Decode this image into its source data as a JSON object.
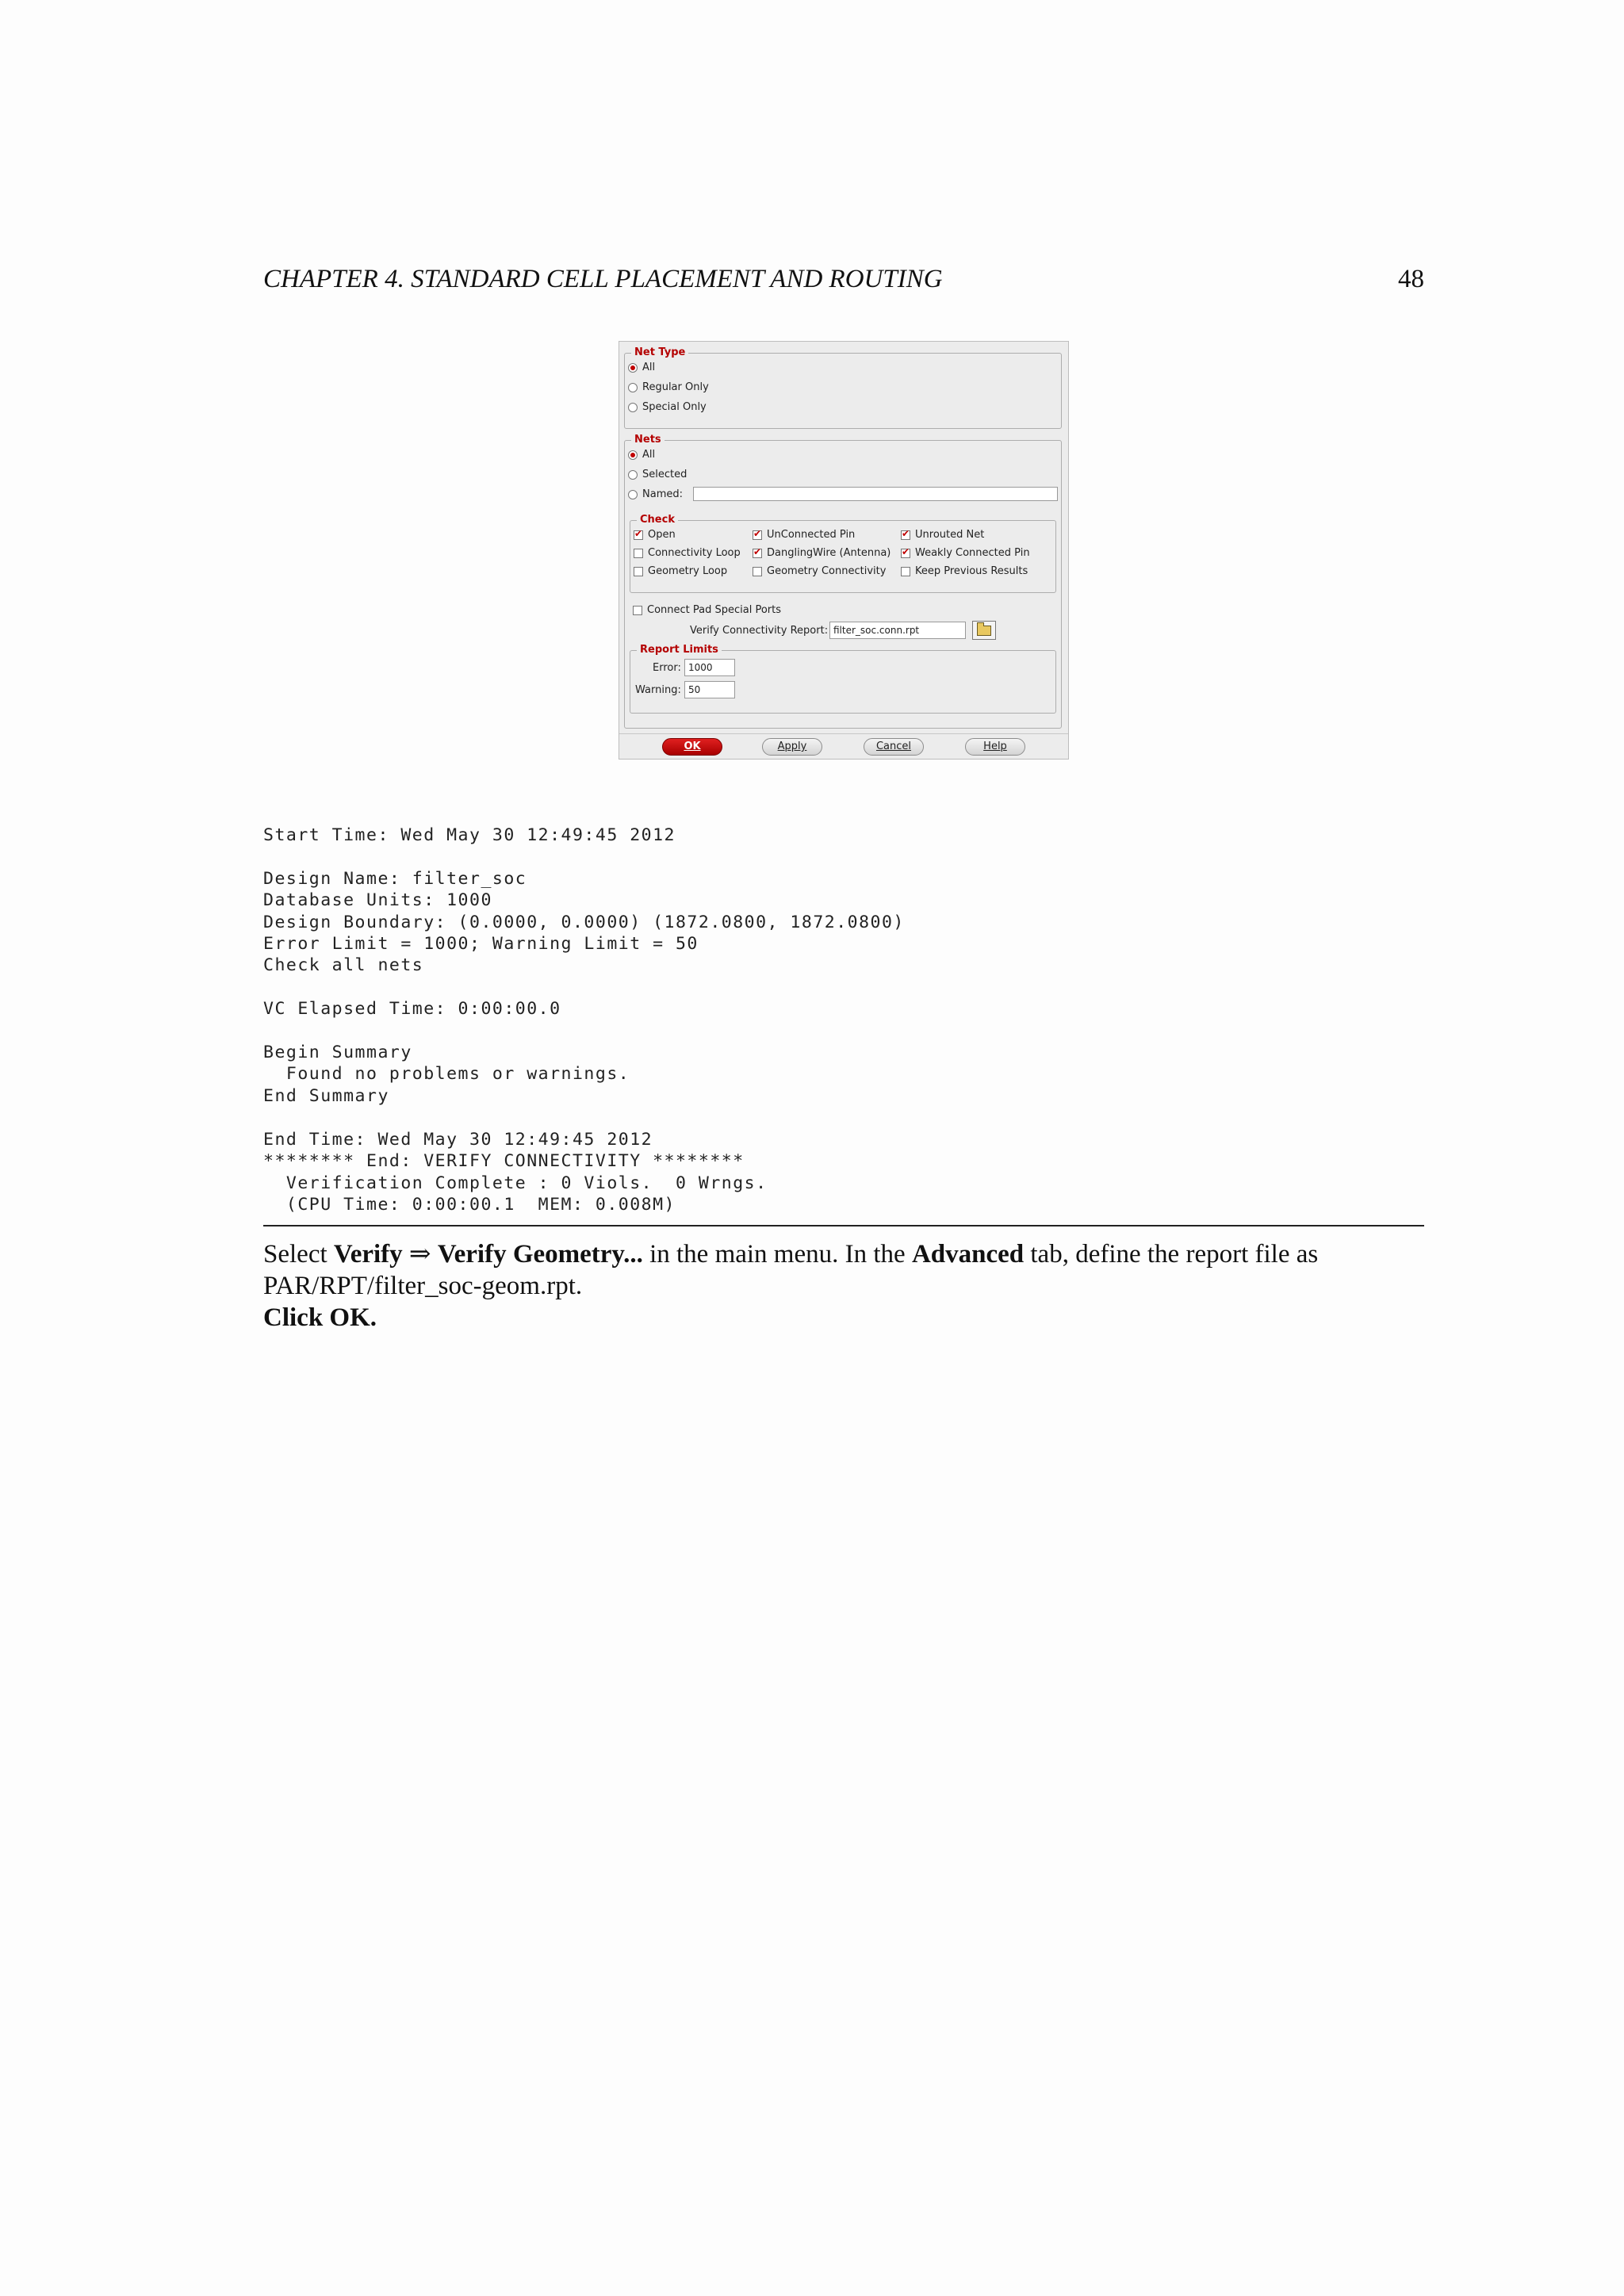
{
  "header": {
    "chapter": "CHAPTER 4.  STANDARD CELL PLACEMENT AND ROUTING",
    "page_number": "48"
  },
  "dialog": {
    "net_type": {
      "legend": "Net Type",
      "options": [
        "All",
        "Regular Only",
        "Special Only"
      ],
      "selected": "All"
    },
    "nets": {
      "legend": "Nets",
      "options": [
        "All",
        "Selected",
        "Named:"
      ],
      "selected": "All",
      "named_value": ""
    },
    "check": {
      "legend": "Check",
      "items": [
        {
          "label": "Open",
          "checked": true
        },
        {
          "label": "UnConnected Pin",
          "checked": true
        },
        {
          "label": "Unrouted Net",
          "checked": true
        },
        {
          "label": "Connectivity Loop",
          "checked": false
        },
        {
          "label": "DanglingWire (Antenna)",
          "checked": true
        },
        {
          "label": "Weakly Connected Pin",
          "checked": true
        },
        {
          "label": "Geometry Loop",
          "checked": false
        },
        {
          "label": "Geometry Connectivity",
          "checked": false
        },
        {
          "label": "Keep Previous Results",
          "checked": false
        }
      ]
    },
    "connect_pad": {
      "label": "Connect Pad Special Ports",
      "checked": false
    },
    "report": {
      "label": "Verify Connectivity Report:",
      "value": "filter_soc.conn.rpt"
    },
    "report_limits": {
      "legend": "Report Limits",
      "error_label": "Error:",
      "error_value": "1000",
      "warning_label": "Warning:",
      "warning_value": "50"
    },
    "buttons": {
      "ok": "OK",
      "apply": "Apply",
      "cancel": "Cancel",
      "help": "Help"
    }
  },
  "log_lines": [
    "Start Time: Wed May 30 12:49:45 2012",
    "",
    "Design Name: filter_soc",
    "Database Units: 1000",
    "Design Boundary: (0.0000, 0.0000) (1872.0800, 1872.0800)",
    "Error Limit = 1000; Warning Limit = 50",
    "Check all nets",
    "",
    "VC Elapsed Time: 0:00:00.0",
    "",
    "Begin Summary",
    "  Found no problems or warnings.",
    "End Summary",
    "",
    "End Time: Wed May 30 12:49:45 2012",
    "******** End: VERIFY CONNECTIVITY ********",
    "  Verification Complete : 0 Viols.  0 Wrngs.",
    "  (CPU Time: 0:00:00.1  MEM: 0.008M)"
  ],
  "instruction": {
    "t1": "Select ",
    "b1": "Verify",
    "arrow": " ⇒ ",
    "b2": "Verify Geometry...",
    "t2": " in the main menu. In the ",
    "b3": "Advanced",
    "t3": " tab, define the report file as",
    "line2": "PAR/RPT/filter_soc-geom.rpt.",
    "line3": "Click OK."
  }
}
